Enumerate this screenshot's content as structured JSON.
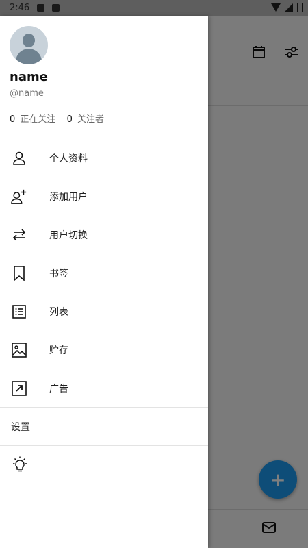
{
  "status_bar": {
    "time": "2:46"
  },
  "profile": {
    "name": "name",
    "handle": "@name"
  },
  "stats": [
    {
      "count": "0",
      "label": "正在关注"
    },
    {
      "count": "0",
      "label": "关注者"
    }
  ],
  "menu": {
    "profile": "个人资料",
    "add_user": "添加用户",
    "switch_user": "用户切换",
    "bookmarks": "书签",
    "lists": "列表",
    "storage": "贮存",
    "ads": "广告",
    "settings": "设置"
  },
  "colors": {
    "fab": "#1d9bf0",
    "scrim": "#000000"
  },
  "icons": [
    "calendar-icon",
    "filter-icon",
    "mail-icon",
    "plus-icon",
    "person-icon",
    "add-person-icon",
    "swap-icon",
    "bookmark-icon",
    "list-icon",
    "image-icon",
    "external-link-icon",
    "lightbulb-icon"
  ]
}
